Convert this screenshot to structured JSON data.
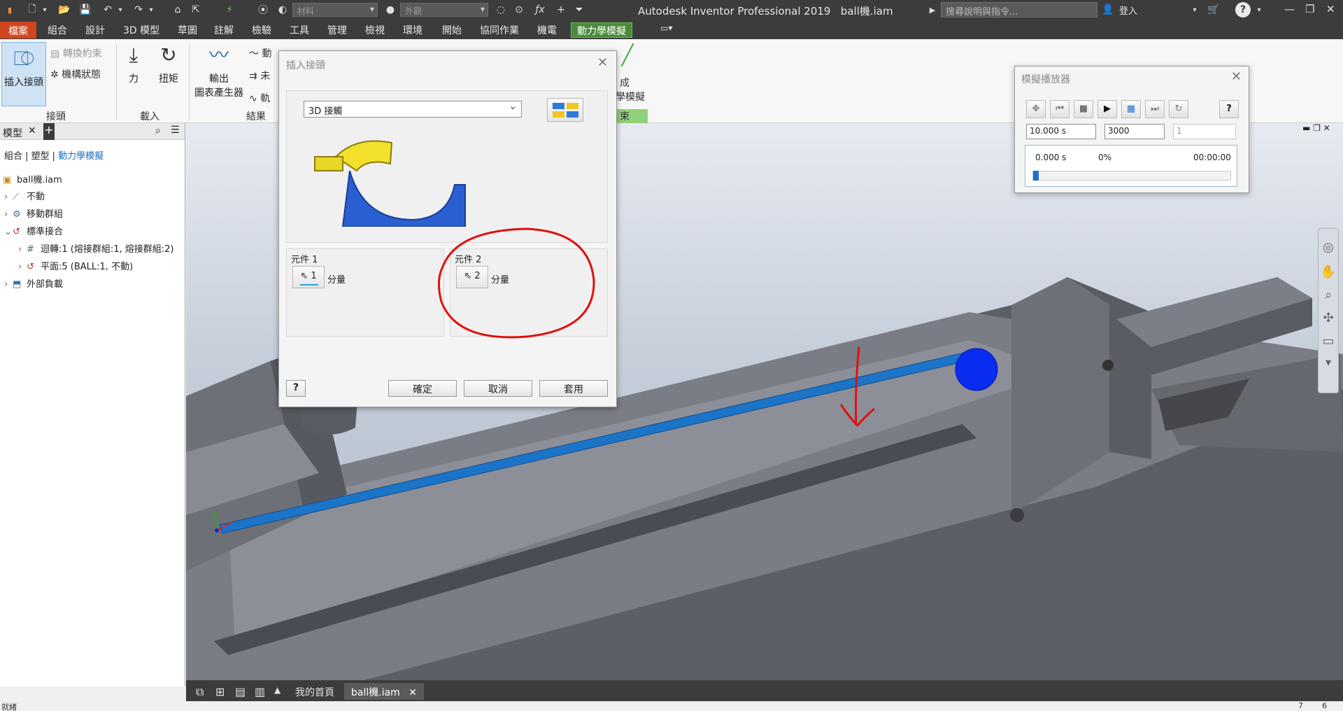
{
  "titlebar": {
    "app_title": "Autodesk Inventor Professional 2019",
    "doc_title": "ball機.iam",
    "material_placeholder": "材料",
    "appearance_placeholder": "外觀",
    "search_placeholder": "搜尋說明與指令...",
    "login_label": "登入",
    "help_label": "?"
  },
  "menu": {
    "tabs": [
      "檔案",
      "組合",
      "設計",
      "3D 模型",
      "草圖",
      "註解",
      "檢驗",
      "工具",
      "管理",
      "檢視",
      "環境",
      "開始",
      "協同作業",
      "機電",
      "動力學模擬"
    ],
    "active": "動力學模擬"
  },
  "ribbon": {
    "insert_joint": "插入接頭",
    "convert_constraints": "轉換約束",
    "mechanism_status": "機構狀態",
    "joint_panel": "接頭",
    "force": "力",
    "torque": "扭矩",
    "load_panel": "載入",
    "output_graph_1": "輸出",
    "output_graph_2": "圖表產生器",
    "results_panel": "結果",
    "dyn_a": "動",
    "dyn_b": "未",
    "dyn_c": "軌",
    "finish_a": "成",
    "finish_b": "學模擬",
    "finish_panel": "束"
  },
  "browser": {
    "title": "模型",
    "modes": [
      "組合",
      "塑型",
      "動力學模擬"
    ],
    "root": "ball機.iam",
    "items": [
      {
        "label": "不動",
        "indent": 1,
        "expanded": false
      },
      {
        "label": "移動群組",
        "indent": 1,
        "expanded": false
      },
      {
        "label": "標準接合",
        "indent": 1,
        "expanded": true
      },
      {
        "label": "迴轉:1 (熔接群組:1, 熔接群組:2)",
        "indent": 2,
        "expanded": false
      },
      {
        "label": "平面:5 (BALL:1, 不動)",
        "indent": 2,
        "expanded": false
      },
      {
        "label": "外部負載",
        "indent": 1,
        "expanded": false
      }
    ]
  },
  "dialog": {
    "title": "插入接頭",
    "joint_type": "3D 接觸",
    "component1_label": "元件 1",
    "component1_num": "1",
    "component1_text": "分量",
    "component2_label": "元件 2",
    "component2_num": "2",
    "component2_text": "分量",
    "ok": "確定",
    "cancel": "取消",
    "apply": "套用",
    "help": "?"
  },
  "player": {
    "title": "模擬播放器",
    "final_time": "10.000 s",
    "images": "3000",
    "filter": "1",
    "current_time": "0.000 s",
    "percent": "0%",
    "elapsed": "00:00:00",
    "progress": 0
  },
  "doctabs": {
    "home": "我的首頁",
    "doc": "ball機.iam"
  },
  "status": {
    "left": "就緒",
    "right_a": "7",
    "right_b": "6"
  },
  "colors": {
    "ribbon_active": "#4a8a3a",
    "file_tab": "#d2461e",
    "ball": "#0a2cf0",
    "track_highlight": "#1b74c8",
    "annotation": "#e01010"
  }
}
